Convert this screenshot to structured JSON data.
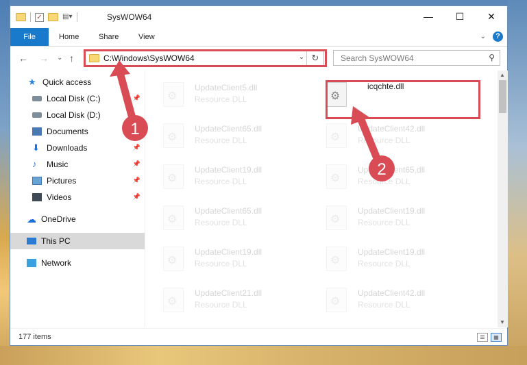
{
  "window": {
    "title": "SysWOW64",
    "controls": {
      "minimize": "—",
      "maximize": "☐",
      "close": "✕"
    }
  },
  "ribbon": {
    "tabs": [
      "File",
      "Home",
      "Share",
      "View"
    ],
    "help": "?"
  },
  "navigation": {
    "back": "←",
    "forward": "→",
    "recent": "⌄",
    "up": "↑",
    "address": "C:\\Windows\\SysWOW64",
    "search_placeholder": "Search SysWOW64"
  },
  "sidebar": {
    "items": [
      {
        "label": "Quick access",
        "icon": "star-icon",
        "pinned": false
      },
      {
        "label": "Local Disk (C:)",
        "icon": "disk-icon",
        "pinned": true
      },
      {
        "label": "Local Disk (D:)",
        "icon": "disk-icon",
        "pinned": false
      },
      {
        "label": "Documents",
        "icon": "documents-icon",
        "pinned": true
      },
      {
        "label": "Downloads",
        "icon": "download-icon",
        "pinned": true
      },
      {
        "label": "Music",
        "icon": "music-icon",
        "pinned": true
      },
      {
        "label": "Pictures",
        "icon": "pictures-icon",
        "pinned": true
      },
      {
        "label": "Videos",
        "icon": "videos-icon",
        "pinned": true
      },
      {
        "label": "OneDrive",
        "icon": "cloud-icon",
        "pinned": false
      },
      {
        "label": "This PC",
        "icon": "pc-icon",
        "pinned": false,
        "selected": true
      },
      {
        "label": "Network",
        "icon": "network-icon",
        "pinned": false
      }
    ]
  },
  "files": {
    "left_column": [
      {
        "name": "UpdateClient5.dll",
        "type": "Resource DLL"
      },
      {
        "name": "UpdateClient65.dll",
        "type": "Resource DLL"
      },
      {
        "name": "UpdateClient19.dll",
        "type": "Resource DLL"
      },
      {
        "name": "UpdateClient65.dll",
        "type": "Resource DLL"
      },
      {
        "name": "UpdateClient19.dll",
        "type": "Resource DLL"
      },
      {
        "name": "UpdateClient21.dll",
        "type": "Resource DLL"
      }
    ],
    "right_column": [
      {
        "name": "icqchte.dll",
        "type": "",
        "highlighted": true
      },
      {
        "name": "UpdateClient42.dll",
        "type": "Resource DLL"
      },
      {
        "name": "UpdateClient65.dll",
        "type": "Resource DLL"
      },
      {
        "name": "UpdateClient19.dll",
        "type": "Resource DLL"
      },
      {
        "name": "UpdateClient19.dll",
        "type": "Resource DLL"
      },
      {
        "name": "UpdateClient42.dll",
        "type": "Resource DLL"
      }
    ]
  },
  "status": {
    "item_count": "177 items"
  },
  "annotations": {
    "step1": "1",
    "step2": "2",
    "color": "#d94b55"
  }
}
